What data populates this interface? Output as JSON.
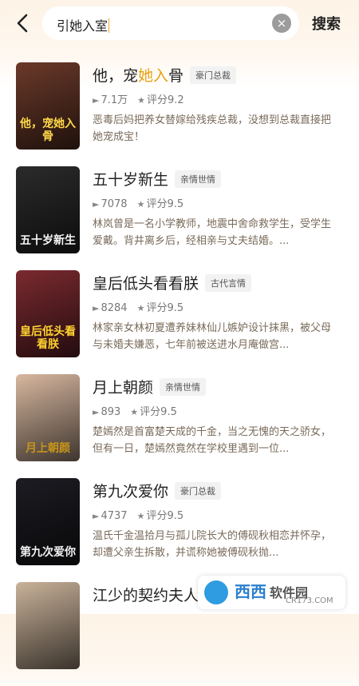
{
  "search": {
    "query": "引她入室",
    "button_label": "搜索",
    "clear_icon": "×"
  },
  "results": [
    {
      "title_parts": [
        "他，宠",
        "她入",
        "骨"
      ],
      "tag": "豪门总裁",
      "views": "7.1万",
      "rating": "评分9.2",
      "desc": "恶毒后妈把养女替嫁给残疾总裁，没想到总裁直接把她宠成宝！",
      "cover_text": "他，宠她入骨",
      "cover_bg": "#6b3a2a",
      "cover_text_color": "#ffd84a"
    },
    {
      "title_parts": [
        "五十岁新生",
        "",
        ""
      ],
      "tag": "亲情世情",
      "views": "7078",
      "rating": "评分9.5",
      "desc": "林岚曾是一名小学教师，地震中舍命救学生，受学生爱戴。背井离乡后，经相亲与丈夫结婚。...",
      "cover_text": "五十岁新生",
      "cover_bg": "#2b2b2b",
      "cover_text_color": "#f5f5f5"
    },
    {
      "title_parts": [
        "皇后低头看看朕",
        "",
        ""
      ],
      "tag": "古代言情",
      "views": "8284",
      "rating": "评分9.5",
      "desc": "林家亲女林初夏遭养妹林仙儿嫉妒设计抹黑，被父母与未婚夫嫌恶，七年前被送进水月庵做宫...",
      "cover_text": "皇后低头看看朕",
      "cover_bg": "#7a2a30",
      "cover_text_color": "#ffd230"
    },
    {
      "title_parts": [
        "月上朝颜",
        "",
        ""
      ],
      "tag": "亲情世情",
      "views": "893",
      "rating": "评分9.5",
      "desc": "楚嫣然是首富楚天成的千金，当之无愧的天之骄女，但有一日，楚嫣然竟然在学校里遇到一位...",
      "cover_text": "月上朝颜",
      "cover_bg": "#d8b8a0",
      "cover_text_color": "#c8941a"
    },
    {
      "title_parts": [
        "第九次爱你",
        "",
        ""
      ],
      "tag": "豪门总裁",
      "views": "4737",
      "rating": "评分9.5",
      "desc": "温氏千金温拾月与孤儿院长大的傅砚秋相恋并怀孕，却遭父亲生拆散，并谎称她被傅砚秋抛...",
      "cover_text": "第九次爱你",
      "cover_bg": "#1c1c22",
      "cover_text_color": "#f0f0f0"
    },
    {
      "title_parts": [
        "江少的契约夫人",
        "",
        ""
      ],
      "tag": "",
      "views": "",
      "rating": "",
      "desc": "",
      "cover_text": "",
      "cover_bg": "#c9b29a",
      "cover_text_color": "#ffffff"
    }
  ],
  "icons": {
    "back": "chevron-left-icon",
    "views": "play-count-icon",
    "rating": "star-icon"
  },
  "watermark": {
    "brand": "西西",
    "site": "CR173.COM",
    "label": "软件园"
  },
  "colors": {
    "highlight": "#e8a010",
    "bg_top": "#fdf3e6",
    "desc": "#7a6a5a"
  }
}
